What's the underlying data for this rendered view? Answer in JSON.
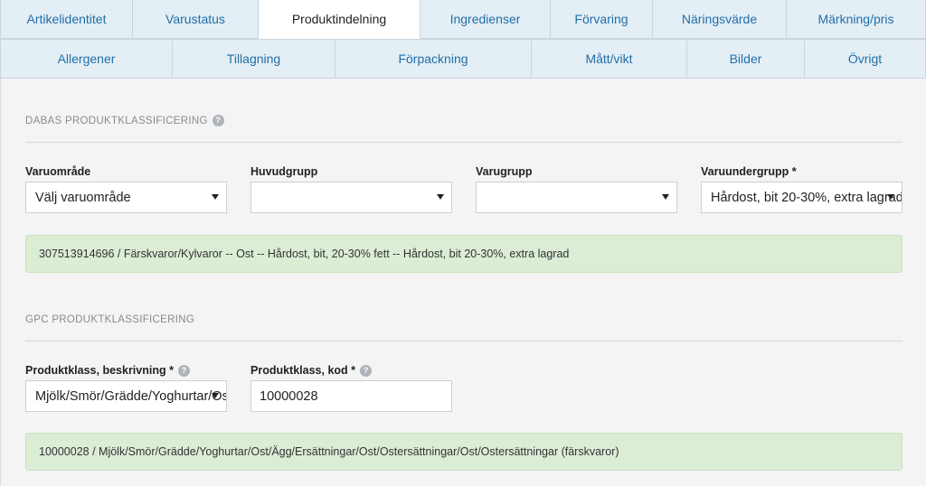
{
  "tabs_row1": [
    {
      "label": "Artikelidentitet"
    },
    {
      "label": "Varustatus"
    },
    {
      "label": "Produktindelning"
    },
    {
      "label": "Ingredienser"
    },
    {
      "label": "Förvaring"
    },
    {
      "label": "Näringsvärde"
    },
    {
      "label": "Märkning/pris"
    }
  ],
  "tabs_row2": [
    {
      "label": "Allergener"
    },
    {
      "label": "Tillagning"
    },
    {
      "label": "Förpackning"
    },
    {
      "label": "Mått/vikt"
    },
    {
      "label": "Bilder"
    },
    {
      "label": "Övrigt"
    }
  ],
  "active_tab": "Produktindelning",
  "dabas": {
    "title": "DABAS PRODUKTKLASSIFICERING",
    "help_icon": "?",
    "fields": [
      {
        "label": "Varuområde",
        "value": "Välj varuområde"
      },
      {
        "label": "Huvudgrupp",
        "value": ""
      },
      {
        "label": "Varugrupp",
        "value": ""
      },
      {
        "label": "Varuundergrupp *",
        "value": "Hårdost, bit 20-30%, extra lagrad"
      }
    ],
    "summary": "307513914696 / Färskvaror/Kylvaror -- Ost -- Hårdost, bit, 20-30% fett -- Hårdost, bit 20-30%, extra lagrad"
  },
  "gpc": {
    "title": "GPC PRODUKTKLASSIFICERING",
    "class_desc_label": "Produktklass, beskrivning *",
    "class_desc_value": "Mjölk/Smör/Grädde/Yoghurtar/Ost/Ägg/Ersättningar",
    "class_code_label": "Produktklass, kod *",
    "class_code_value": "10000028",
    "help_icon": "?",
    "summary": "10000028 / Mjölk/Smör/Grädde/Yoghurtar/Ost/Ägg/Ersättningar/Ost/Ostersättningar/Ost/Ostersättningar (färskvaror)"
  },
  "colors": {
    "tab_bg": "#e4eef5",
    "tab_text": "#1f6fa8",
    "info_bg": "#dcedd6"
  }
}
